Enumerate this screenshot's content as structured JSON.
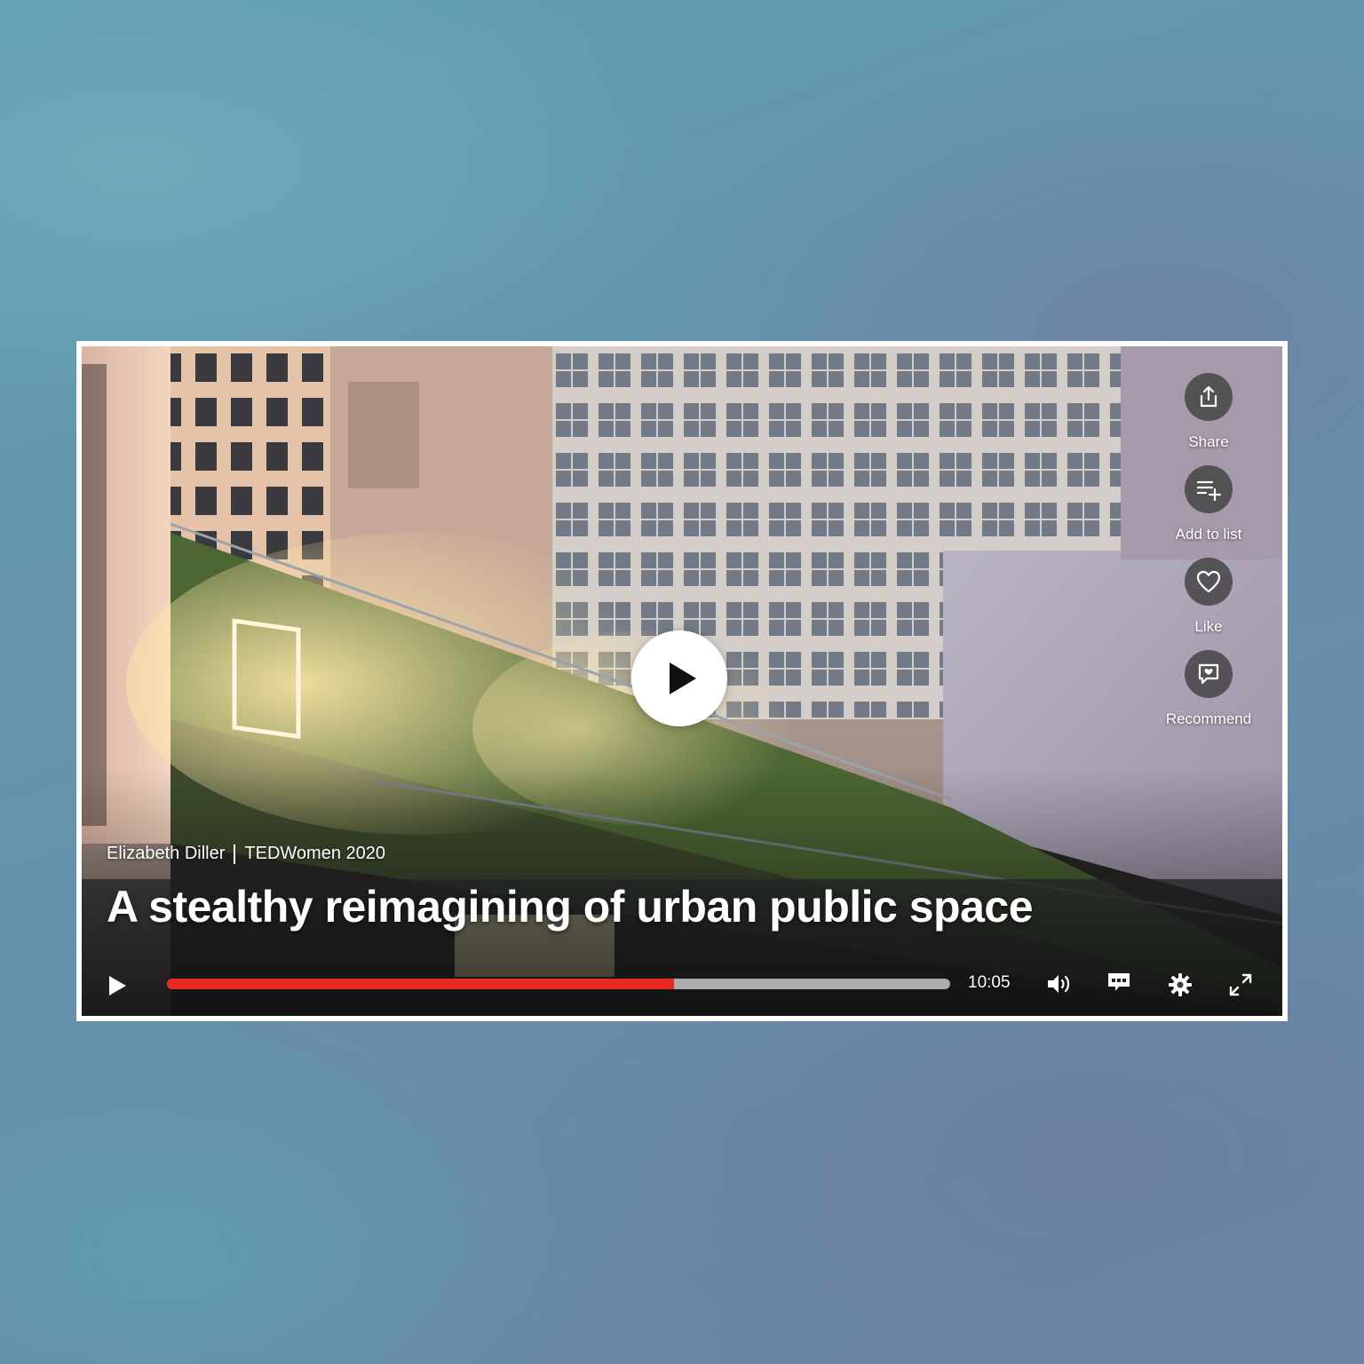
{
  "video": {
    "speaker": "Elizabeth Diller",
    "event": "TEDWomen 2020",
    "title": "A stealthy reimagining of urban public space",
    "duration": "10:05",
    "progress_fraction": 0.647
  },
  "actions": [
    {
      "label": "Share",
      "icon": "share-icon"
    },
    {
      "label": "Add to list",
      "icon": "add-to-list-icon"
    },
    {
      "label": "Like",
      "icon": "heart-icon"
    },
    {
      "label": "Recommend",
      "icon": "recommend-icon"
    }
  ],
  "controls": {
    "play_icon": "play-icon",
    "volume_icon": "volume-icon",
    "captions_icon": "captions-icon",
    "settings_icon": "gear-icon",
    "fullscreen_icon": "fullscreen-icon"
  },
  "colors": {
    "accent": "#e62b1e",
    "track": "#c8c8c8",
    "frame": "#ffffff"
  }
}
